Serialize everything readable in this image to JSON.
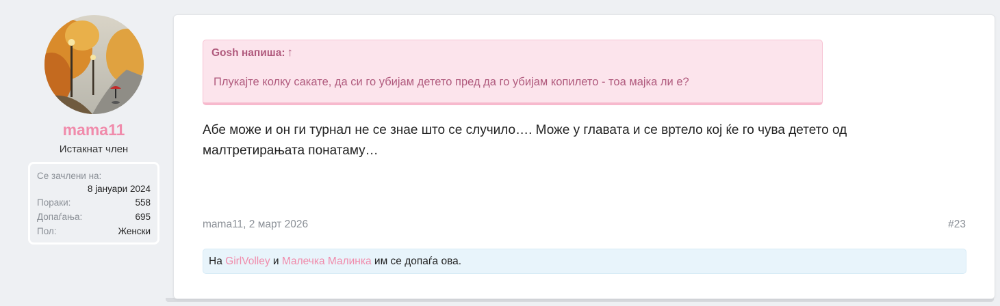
{
  "user": {
    "username": "mama11",
    "title": "Истакнат член",
    "joined_label": "Се зачлени на:",
    "joined_value": "8 јануари 2024",
    "messages_label": "Пораки:",
    "messages_value": "558",
    "likes_label": "Допаѓања:",
    "likes_value": "695",
    "gender_label": "Пол:",
    "gender_value": "Женски"
  },
  "quote": {
    "author": "Gosh напиша:",
    "arrow": "↑",
    "text": "Плукајте колку сакате, да си го убијам детето пред да го убијам копилето - тоа мајка ли е?"
  },
  "message": {
    "text": "Абе може и он ги турнал не се знае што се случило…. Може у главата и се вртело кој ќе го чува детето од малтретирањата понатаму…"
  },
  "meta": {
    "author_date": "mama11, 2 март 2026",
    "post_number": "#23"
  },
  "reactions": {
    "prefix": "На",
    "user1": "GirlVolley",
    "conjunction": "и",
    "user2": "Малечка Малинка",
    "suffix": "им се допаѓа ова."
  },
  "colors": {
    "accent": "#f08bab",
    "quote_bg": "#fce4ec",
    "quote_text": "#b05a7d",
    "reactions_bg": "#e8f4fb",
    "page_bg": "#eef0f3"
  }
}
